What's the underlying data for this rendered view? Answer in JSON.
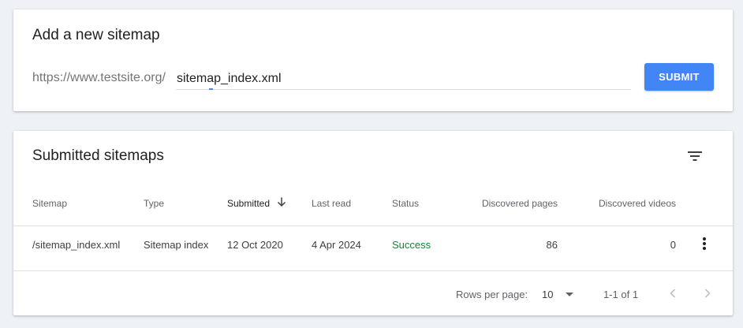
{
  "add_card": {
    "title": "Add a new sitemap",
    "url_prefix": "https://www.testsite.org/",
    "input_value": "sitemap_index.xml",
    "submit_label": "SUBMIT"
  },
  "list_card": {
    "title": "Submitted sitemaps",
    "filter_icon": "filter-list-icon",
    "columns": {
      "sitemap": "Sitemap",
      "type": "Type",
      "submitted": "Submitted",
      "last_read": "Last read",
      "status": "Status",
      "discovered_pages": "Discovered pages",
      "discovered_videos": "Discovered videos"
    },
    "sort_column": "submitted",
    "sort_icon": "arrow-down-icon",
    "rows": [
      {
        "sitemap": "/sitemap_index.xml",
        "type": "Sitemap index",
        "submitted": "12 Oct 2020",
        "last_read": "4 Apr 2024",
        "status": "Success",
        "discovered_pages": "86",
        "discovered_videos": "0"
      }
    ],
    "row_menu_icon": "more-vert-icon",
    "pagination": {
      "rows_per_page_label": "Rows per page:",
      "rows_per_page_value": "10",
      "range_label": "1-1 of 1"
    }
  },
  "colors": {
    "background": "#eef1f6",
    "accent": "#4285f4",
    "success": "#188038"
  }
}
